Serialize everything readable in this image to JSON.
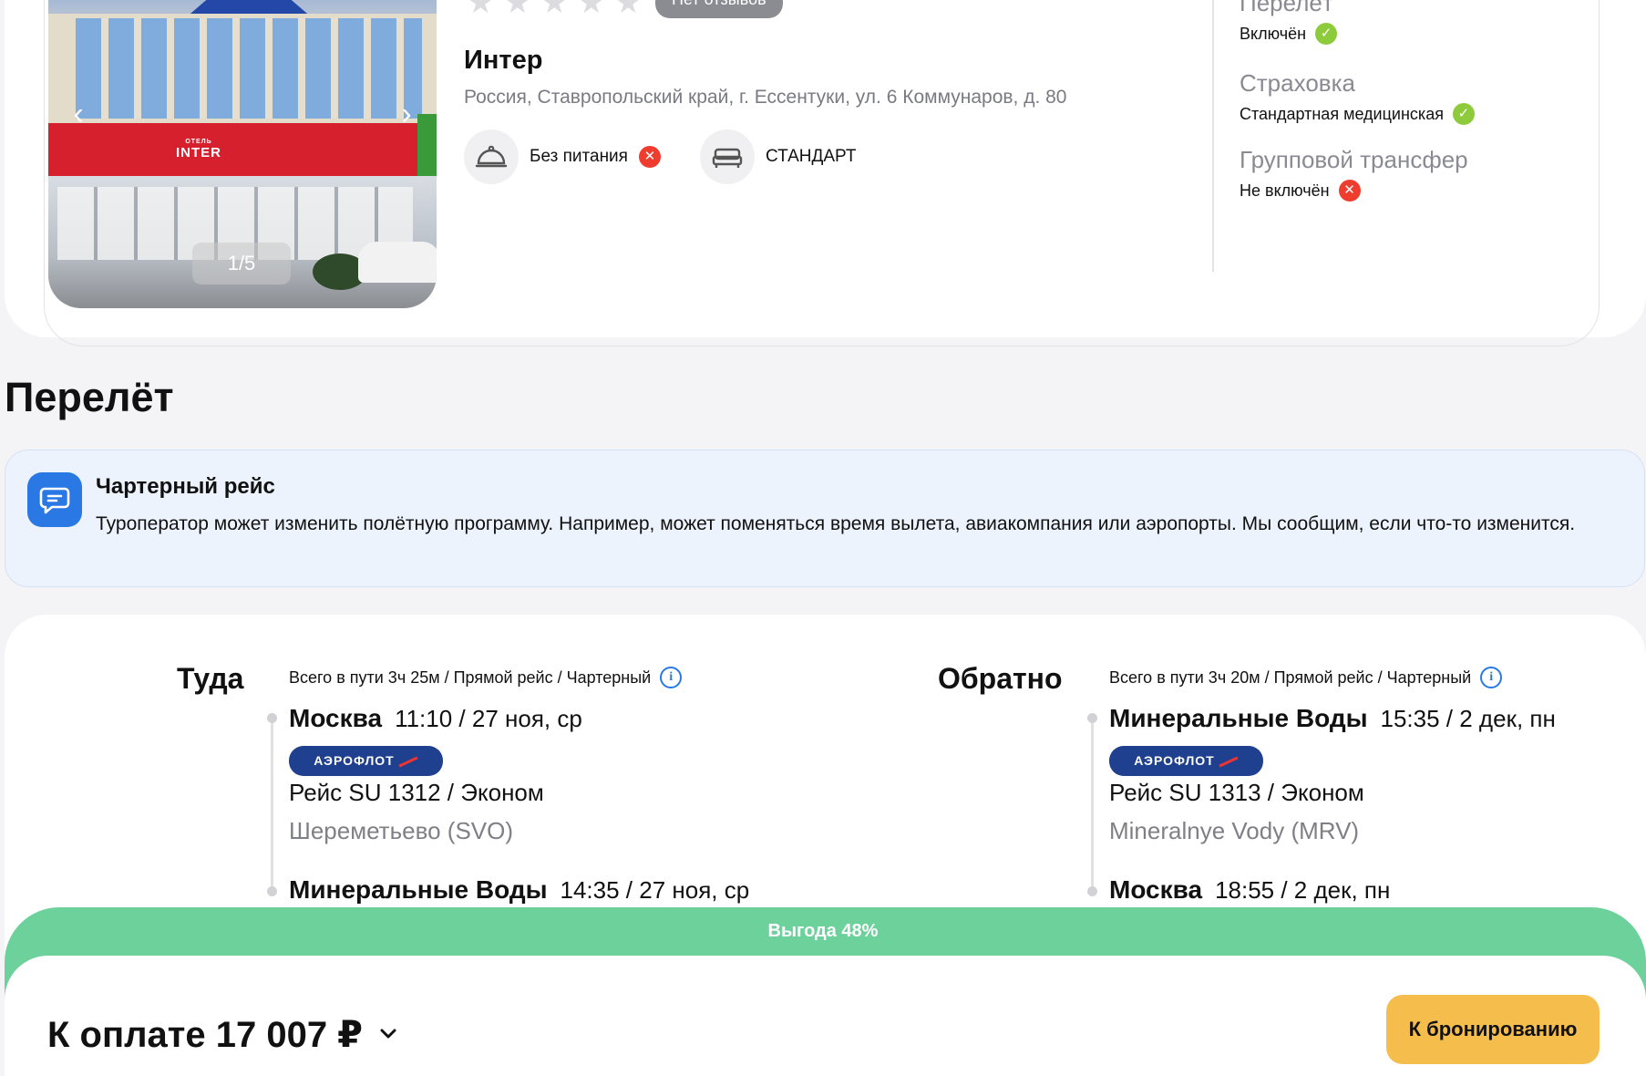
{
  "hotel": {
    "stars_count": 5,
    "reviews_badge": "Нет отзывов",
    "name": "Интер",
    "address": "Россия, Ставропольский край, г. Ессентуки, ул. 6 Коммунаров, д. 80",
    "photo_counter": "1/5",
    "photo_sign": "INTER",
    "photo_sign_small": "ОТЕЛЬ",
    "meal": "Без питания",
    "room": "СТАНДАРТ"
  },
  "included": [
    {
      "title": "Перелёт",
      "value": "Включён",
      "status": "ok"
    },
    {
      "title": "Страховка",
      "value": "Стандартная медицинская",
      "status": "ok"
    },
    {
      "title": "Групповой трансфер",
      "value": "Не включён",
      "status": "no"
    }
  ],
  "flight_section": {
    "title": "Перелёт",
    "notice_title": "Чартерный рейс",
    "notice_text": "Туроператор может изменить полётную программу. Например, может поменяться время вылета, авиакомпания или аэропорты. Мы сообщим, если что-то изменится."
  },
  "outbound": {
    "title": "Туда",
    "meta": "Всего в пути 3ч 25м / Прямой рейс / Чартерный",
    "from_city": "Москва",
    "from_time": "11:10 / 27 ноя, ср",
    "airline": "АЭРОФЛОТ",
    "flight": "Рейс SU 1312 / Эконом",
    "airport": "Шереметьево (SVO)",
    "to_city": "Минеральные Воды",
    "to_time": "14:35 / 27 ноя, ср"
  },
  "return": {
    "title": "Обратно",
    "meta": "Всего в пути 3ч 20м / Прямой рейс / Чартерный",
    "from_city": "Минеральные Воды",
    "from_time": "15:35 / 2 дек, пн",
    "airline": "АЭРОФЛОТ",
    "flight": "Рейс SU 1313 / Эконом",
    "airport": "Mineralnye Vody (MRV)",
    "to_city": "Москва",
    "to_time": "18:55 / 2 дек, пн"
  },
  "bottom": {
    "savings": "Выгода 48%",
    "pay_label": "К оплате 17 007 ₽",
    "book_button": "К бронированию"
  },
  "colors": {
    "accent_blue": "#2a78e4",
    "savings_green": "#6dd19c",
    "button_yellow": "#f5bd4b",
    "status_ok": "#8ecb3c",
    "status_no": "#ee3c2f",
    "aeroflot_blue": "#1f3f8f"
  }
}
